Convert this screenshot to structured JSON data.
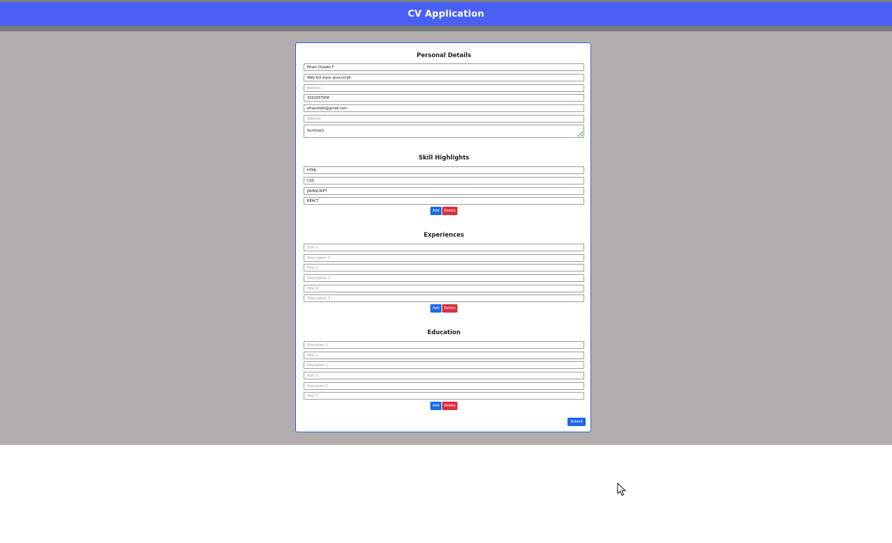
{
  "app": {
    "title": "CV Application"
  },
  "personal": {
    "heading": "Personal Details",
    "name": "Efrain Oviedo T",
    "role": "Web full stack java-script",
    "address_placeholder": "Address",
    "phone": "3202937958",
    "email": "efraoviedo@gmail.com",
    "website_placeholder": "Website",
    "summary": "Summary"
  },
  "skills": {
    "heading": "Skill Highlights",
    "items": [
      "HTML",
      "CSS",
      "JAVASCRIPT",
      "REACT"
    ],
    "add_label": "Add",
    "delete_label": "Delete"
  },
  "experiences": {
    "heading": "Experiences",
    "placeholders": [
      "Title 1",
      "Description 1",
      "Title 2",
      "Description 2",
      "Title 3",
      "Description 3"
    ],
    "add_label": "Add",
    "delete_label": "Delete"
  },
  "education": {
    "heading": "Education",
    "placeholders": [
      "Education 1",
      "Year 1",
      "Education 2",
      "Year 2",
      "Education 3",
      "Year 3"
    ],
    "add_label": "Add",
    "delete_label": "Delete"
  },
  "submit_label": "Submit",
  "colors": {
    "header": "#4a5ff4",
    "background": "#b3adad",
    "primary_button": "#1b6ae8",
    "danger_button": "#d9303e",
    "card_border": "#2b66d8"
  },
  "icons": {
    "cursor": "mouse-pointer-icon"
  }
}
